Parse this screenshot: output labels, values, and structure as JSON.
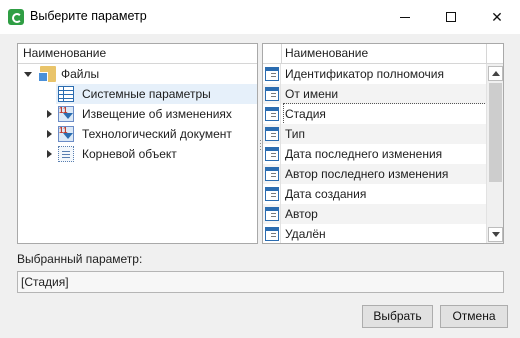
{
  "window": {
    "title": "Выберите параметр",
    "controls": {
      "minimize": "minimize",
      "maximize": "maximize",
      "close": "✕"
    }
  },
  "tree": {
    "header": "Наименование",
    "items": [
      {
        "label": "Файлы",
        "icon": "folder-icon",
        "expander": "expanded"
      },
      {
        "label": "Системные параметры",
        "icon": "table-icon",
        "selected": true
      },
      {
        "label": "Извещение об изменениях",
        "icon": "notice-icon",
        "expander": "collapsed"
      },
      {
        "label": "Технологический документ",
        "icon": "notice-icon",
        "expander": "collapsed"
      },
      {
        "label": "Корневой объект",
        "icon": "root-object-icon",
        "expander": "collapsed"
      }
    ]
  },
  "list": {
    "header": "Наименование",
    "rows": [
      {
        "label": "Идентификатор полномочия"
      },
      {
        "label": "От имени"
      },
      {
        "label": "Стадия",
        "selected": true
      },
      {
        "label": "Тип"
      },
      {
        "label": "Дата последнего изменения"
      },
      {
        "label": "Автор последнего изменения"
      },
      {
        "label": "Дата создания"
      },
      {
        "label": "Автор"
      },
      {
        "label": "Удалён"
      }
    ]
  },
  "selection": {
    "label": "Выбранный параметр:",
    "value": "[Стадия]"
  },
  "buttons": {
    "select": "Выбрать",
    "cancel": "Отмена"
  },
  "colors": {
    "accent": "#2f9e44",
    "selection_bg": "#e6f0fa",
    "alt_row_bg": "#f3f3f3"
  }
}
